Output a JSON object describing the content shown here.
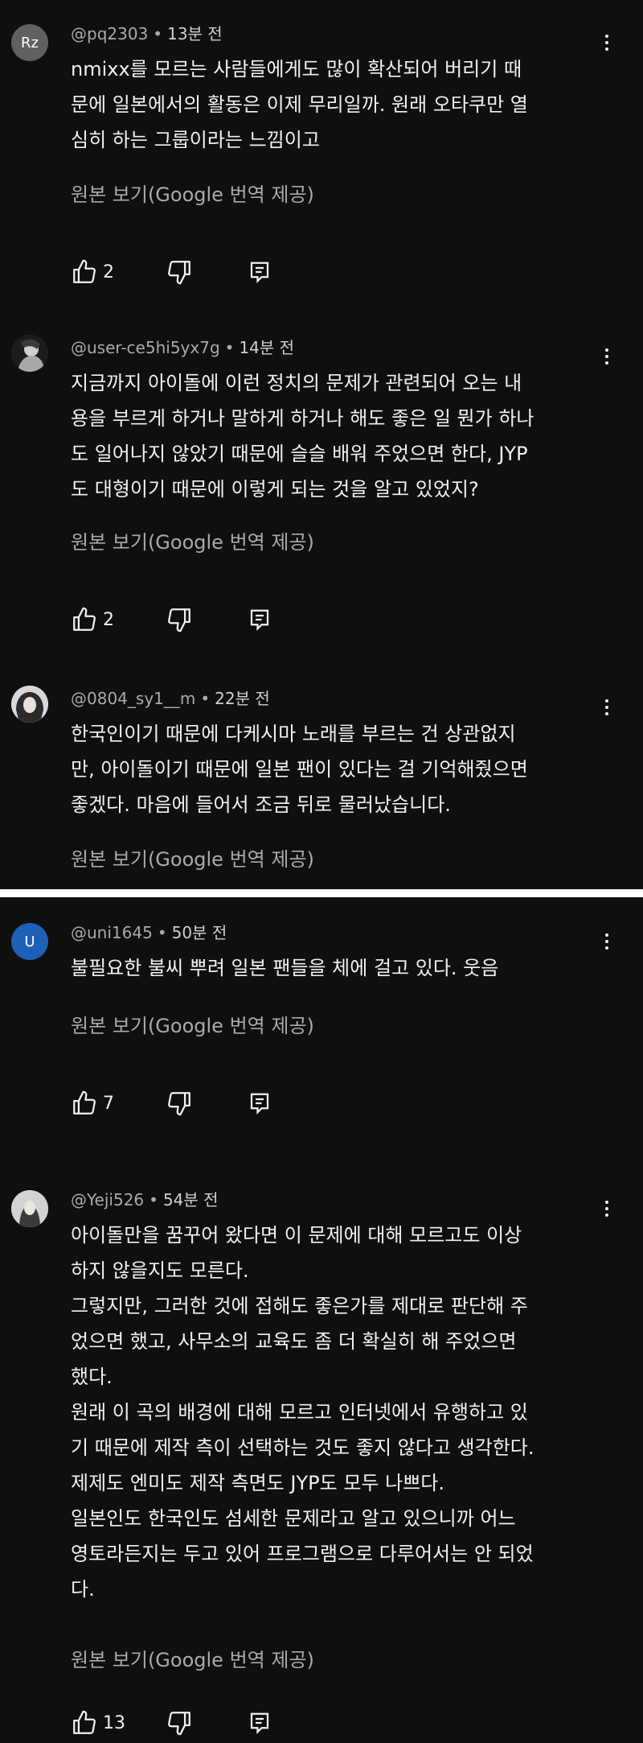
{
  "translate_label": "원본 보기(Google 번역 제공)",
  "comments": [
    {
      "avatar_text": "Rz",
      "avatar_color": "#606060",
      "username": "@pq2303",
      "time": "13분 전",
      "lines": [
        "nmixx를 모르는 사람들에게도 많이 확산되어 버리기 때",
        "문에 일본에서의 활동은 이제 무리일까. 원래 오타쿠만 열",
        "심히 하는 그룹이라는 느낌이고"
      ],
      "likes": "2"
    },
    {
      "avatar_text": "",
      "avatar_color": "#2a2a2a",
      "username": "@user-ce5hi5yx7g",
      "time": "14분 전",
      "lines": [
        "지금까지 아이돌에 이런 정치의 문제가 관련되어 오는 내",
        "용을 부르게 하거나 말하게 하거나 해도 좋은 일 뭔가 하나",
        "도 일어나지 않았기 때문에 슬슬 배워 주었으면 한다, JYP",
        "도 대형이기 때문에 이렇게 되는 것을 알고 있었지?"
      ],
      "likes": "2"
    },
    {
      "avatar_text": "",
      "avatar_color": "#d8d8d8",
      "username": "@0804_sy1__m",
      "time": "22분 전",
      "lines": [
        "한국인이기 때문에 다케시마 노래를 부르는 건 상관없지",
        "만, 아이돌이기 때문에 일본 팬이 있다는 걸 기억해줬으면",
        "좋겠다. 마음에 들어서 조금 뒤로 물러났습니다."
      ],
      "likes": ""
    },
    {
      "avatar_text": "U",
      "avatar_color": "#1e5fb8",
      "username": "@uni1645",
      "time": "50분 전",
      "lines": [
        "불필요한 불씨 뿌려 일본 팬들을 체에 걸고 있다. 웃음"
      ],
      "likes": "7"
    },
    {
      "avatar_text": "",
      "avatar_color": "#cfcfcf",
      "username": "@Yeji526",
      "time": "54분 전",
      "lines": [
        "아이돌만을 꿈꾸어 왔다면 이 문제에 대해 모르고도 이상",
        "하지 않을지도 모른다.",
        "그렇지만, 그러한 것에 접해도 좋은가를 제대로 판단해 주",
        "었으면 했고, 사무소의 교육도 좀 더 확실히 해 주었으면",
        "했다.",
        "원래 이 곡의 배경에 대해 모르고 인터넷에서 유행하고 있",
        "기 때문에 제작 측이 선택하는 것도 좋지 않다고 생각한다.",
        "제제도 엔미도 제작 측면도 JYP도 모두 나쁘다.",
        "일본인도 한국인도 섬세한 문제라고 알고 있으니까 어느",
        "영토라든지는 두고 있어 프로그램으로 다루어서는 안 되었",
        "다."
      ],
      "likes": "13"
    }
  ]
}
